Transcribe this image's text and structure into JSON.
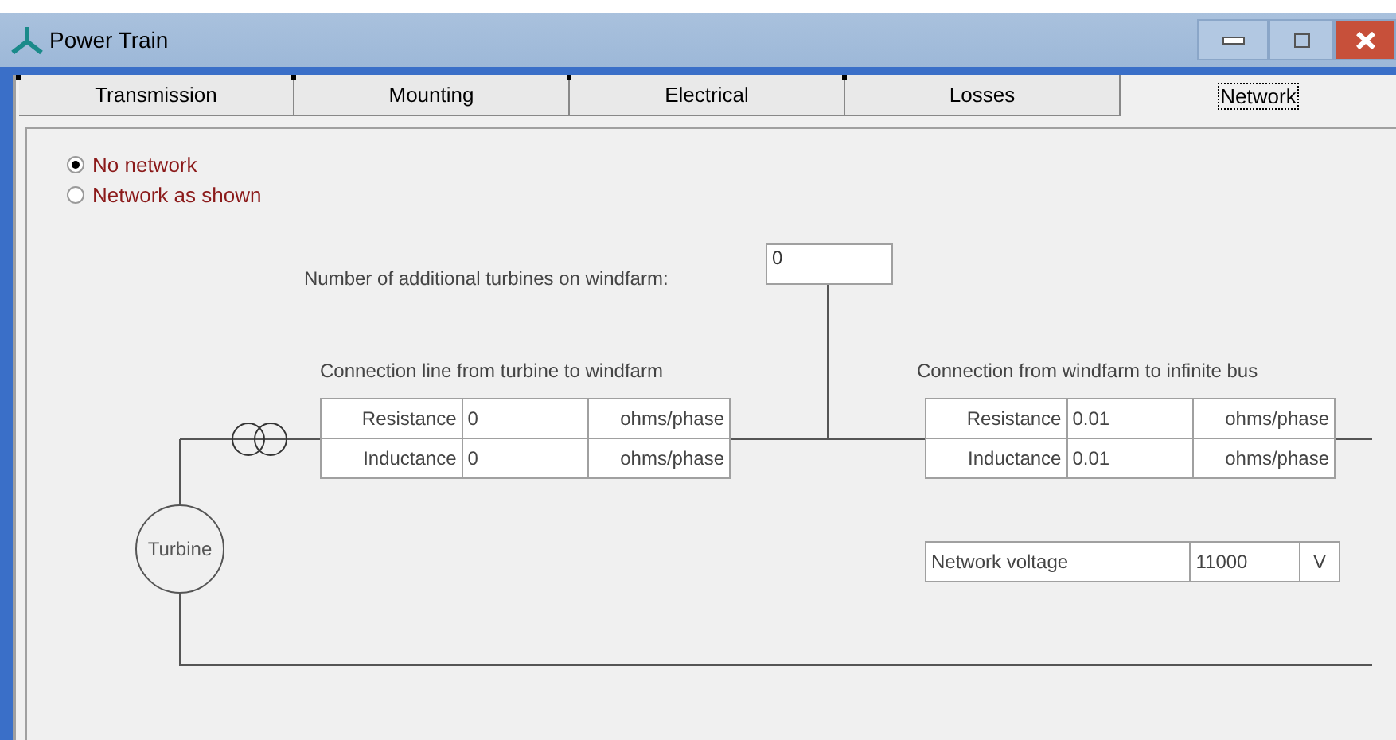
{
  "window": {
    "title": "Power Train"
  },
  "tabs": [
    {
      "label": "Transmission",
      "selected": false
    },
    {
      "label": "Mounting",
      "selected": false
    },
    {
      "label": "Electrical",
      "selected": false
    },
    {
      "label": "Losses",
      "selected": false
    },
    {
      "label": "Network",
      "selected": true
    }
  ],
  "options": [
    {
      "label": "No network",
      "selected": true
    },
    {
      "label": "Network as shown",
      "selected": false
    }
  ],
  "turbines": {
    "label": "Number of additional turbines on windfarm:",
    "value": "0"
  },
  "lines": [
    {
      "title": "Connection line from turbine to windfarm",
      "rows": [
        {
          "label": "Resistance",
          "value": "0",
          "unit": "ohms/phase"
        },
        {
          "label": "Inductance",
          "value": "0",
          "unit": "ohms/phase"
        }
      ]
    },
    {
      "title": "Connection from windfarm to infinite bus",
      "rows": [
        {
          "label": "Resistance",
          "value": "0.01",
          "unit": "ohms/phase"
        },
        {
          "label": "Inductance",
          "value": "0.01",
          "unit": "ohms/phase"
        }
      ]
    }
  ],
  "voltage": {
    "label": "Network voltage",
    "value": "11000",
    "unit": "V"
  },
  "turbine_label": "Turbine"
}
